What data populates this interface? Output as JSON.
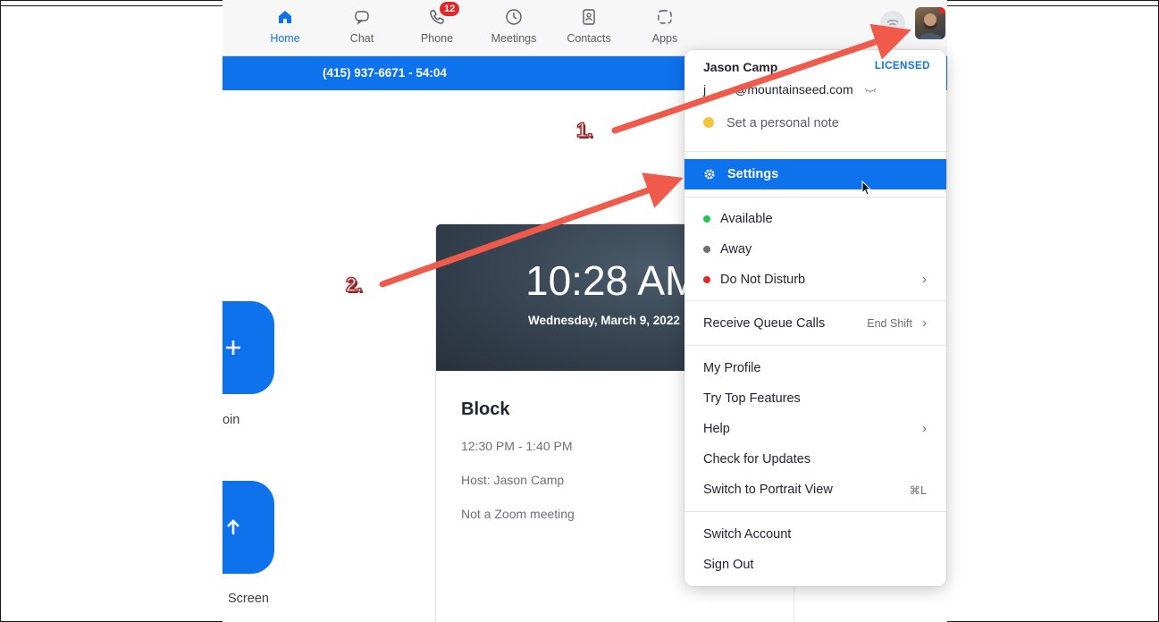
{
  "tabs": [
    {
      "label": "Home",
      "icon": "home-icon",
      "active": true
    },
    {
      "label": "Chat",
      "icon": "chat-icon"
    },
    {
      "label": "Phone",
      "icon": "phone-icon",
      "badge": "12"
    },
    {
      "label": "Meetings",
      "icon": "clock-icon"
    },
    {
      "label": "Contacts",
      "icon": "contacts-icon"
    },
    {
      "label": "Apps",
      "icon": "apps-icon"
    }
  ],
  "call_bar": {
    "text": "(415) 937-6671 - 54:04"
  },
  "side_labels": {
    "join": "oin",
    "share": "Screen"
  },
  "calendar": {
    "time": "10:28 AM",
    "date": "Wednesday, March 9, 2022",
    "event_title": "Block",
    "event_time": "12:30 PM - 1:40 PM",
    "event_host": "Host: Jason Camp",
    "event_note": "Not a Zoom meeting"
  },
  "menu": {
    "user_name": "Jason Camp",
    "license": "LICENSED",
    "email_prefix": "j",
    "email_domain": "@mountainseed.com",
    "note": "Set a personal note",
    "settings": "Settings",
    "status_available": "Available",
    "status_away": "Away",
    "status_dnd": "Do Not Disturb",
    "queue_calls": "Receive Queue Calls",
    "queue_value": "End Shift",
    "my_profile": "My Profile",
    "try_features": "Try Top Features",
    "help": "Help",
    "check_updates": "Check for Updates",
    "portrait_view": "Switch to Portrait View",
    "portrait_shortcut": "⌘L",
    "switch_account": "Switch Account",
    "sign_out": "Sign Out"
  },
  "annotations": {
    "step1": "1.",
    "step2": "2."
  },
  "colors": {
    "accent": "#0e72ed",
    "arrow": "#f05a4a",
    "available": "#23c55e",
    "away": "#6e6e78",
    "dnd": "#e02828"
  }
}
